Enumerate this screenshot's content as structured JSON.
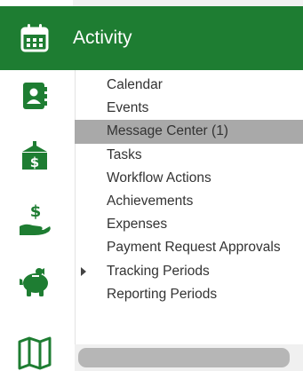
{
  "header": {
    "title": "Activity",
    "icon": "calendar-icon",
    "color": "#1e7d32"
  },
  "rail": {
    "icons": [
      "address-book-icon",
      "gift-receipt-icon",
      "hand-money-icon",
      "piggy-bank-icon",
      "map-icon"
    ],
    "color": "#1e7d32"
  },
  "menu": {
    "items": [
      {
        "label": "Calendar"
      },
      {
        "label": "Events"
      },
      {
        "label": "Message Center (1)",
        "active": true
      },
      {
        "label": "Tasks"
      },
      {
        "label": "Workflow Actions"
      },
      {
        "label": "Achievements"
      },
      {
        "label": "Expenses"
      },
      {
        "label": "Payment Request Approvals"
      },
      {
        "label": "Tracking Periods",
        "expandable": true
      },
      {
        "label": "Reporting Periods"
      }
    ],
    "active_bg": "#a9a9a9"
  }
}
